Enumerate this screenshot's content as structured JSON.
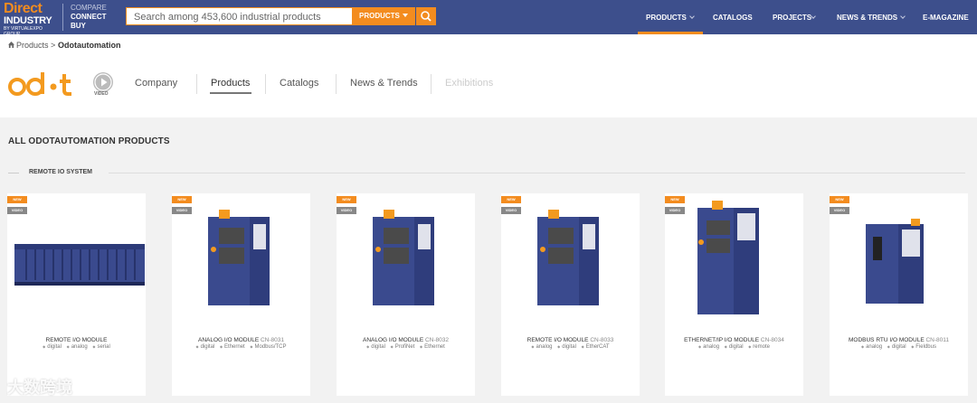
{
  "brand": {
    "line1": "Direct",
    "line2": "INDUSTRY",
    "line3": "BY VIRTUALEXPO GROUP",
    "tagline": [
      "COMPARE",
      "CONNECT",
      "BUY"
    ]
  },
  "search": {
    "placeholder": "Search among 453,600 industrial products",
    "type_label": "PRODUCTS"
  },
  "nav": [
    {
      "label": "PRODUCTS",
      "has_caret": true,
      "active": true
    },
    {
      "label": "CATALOGS",
      "has_caret": false
    },
    {
      "label": "PROJECTS",
      "has_caret": true
    },
    {
      "label": "NEWS & TRENDS",
      "has_caret": true
    },
    {
      "label": "E-MAGAZINE",
      "has_caret": false
    }
  ],
  "breadcrumb": {
    "root": "Products",
    "separator": ">",
    "current": "Odotautomation"
  },
  "company": {
    "video_label": "VIDEO",
    "tabs": [
      {
        "label": "Company"
      },
      {
        "label": "Products",
        "active": true
      },
      {
        "label": "Catalogs"
      },
      {
        "label": "News & Trends"
      },
      {
        "label": "Exhibitions",
        "disabled": true
      }
    ]
  },
  "section": {
    "title": "ALL ODOTAUTOMATION PRODUCTS",
    "subsection": "REMOTE IO SYSTEM"
  },
  "badges": {
    "new": "NEW",
    "video": "VIDEO"
  },
  "products": [
    {
      "name": "REMOTE I/O MODULE",
      "code": "",
      "tags": [
        "digital",
        "analog",
        "serial"
      ]
    },
    {
      "name": "ANALOG I/O MODULE",
      "code": "CN-8031",
      "tags": [
        "digital",
        "Ethernet",
        "Modbus/TCP"
      ]
    },
    {
      "name": "ANALOG I/O MODULE",
      "code": "CN-8032",
      "tags": [
        "digital",
        "ProfiNet",
        "Ethernet"
      ]
    },
    {
      "name": "REMOTE I/O MODULE",
      "code": "CN-8033",
      "tags": [
        "analog",
        "digital",
        "EtherCAT"
      ]
    },
    {
      "name": "ETHERNET/IP I/O MODULE",
      "code": "CN-8034",
      "tags": [
        "analog",
        "digital",
        "remote"
      ]
    },
    {
      "name": "MODBUS RTU I/O MODULE",
      "code": "CN-8011",
      "tags": [
        "analog",
        "digital",
        "Fieldbus"
      ]
    }
  ],
  "watermark": "大数跨境",
  "colors": {
    "header_bg": "#3d4f8c",
    "accent": "#f38c1f",
    "module_blue": "#3a4a8e"
  }
}
